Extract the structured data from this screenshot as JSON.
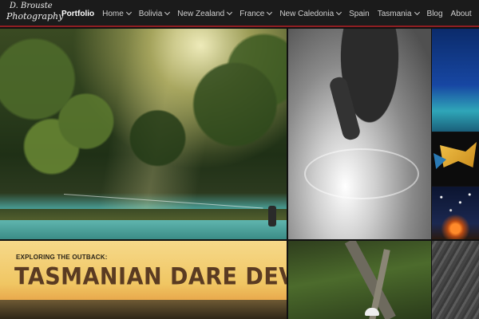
{
  "site": {
    "logo_line1": "D. Brouste",
    "logo_line2": "Photography"
  },
  "nav": {
    "items": [
      {
        "label": "Portfolio",
        "dropdown": false,
        "active": true
      },
      {
        "label": "Home",
        "dropdown": true
      },
      {
        "label": "Bolivia",
        "dropdown": true
      },
      {
        "label": "New Zealand",
        "dropdown": true
      },
      {
        "label": "France",
        "dropdown": true
      },
      {
        "label": "New Caledonia",
        "dropdown": true
      },
      {
        "label": "Spain",
        "dropdown": false
      },
      {
        "label": "Tasmania",
        "dropdown": true
      },
      {
        "label": "Blog",
        "dropdown": false
      },
      {
        "label": "About",
        "dropdown": false
      }
    ]
  },
  "featured": {
    "kicker": "EXPLORING THE OUTBACK:",
    "headline": "TASMANIAN DARE DEVILS"
  },
  "colors": {
    "nav_background": "#1b1b1b",
    "nav_accent_border": "#8e1e22",
    "headline": "#5a3b22"
  }
}
